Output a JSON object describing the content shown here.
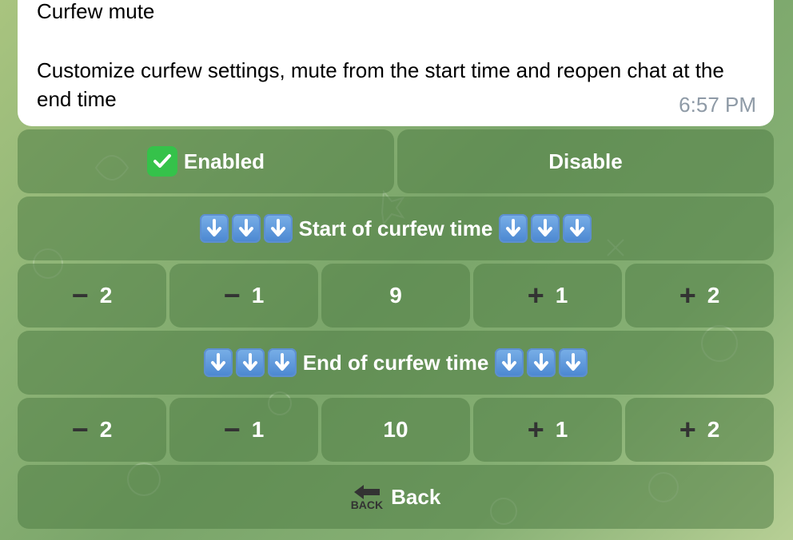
{
  "message": {
    "title": "Curfew mute",
    "body": "Customize curfew settings, mute from the start time and reopen chat at the end time",
    "time": "6:57 PM"
  },
  "keyboard": {
    "enabled_label": "Enabled",
    "disable_label": "Disable",
    "start_header": "Start of curfew time",
    "end_header": "End of curfew time",
    "start_row": {
      "minus2": "2",
      "minus1": "1",
      "value": "9",
      "plus1": "1",
      "plus2": "2"
    },
    "end_row": {
      "minus2": "2",
      "minus1": "1",
      "value": "10",
      "plus1": "1",
      "plus2": "2"
    },
    "back_label": "Back",
    "back_icon_text": "BACK"
  },
  "icons": {
    "enabled": "check-mark-icon",
    "arrows": "down-arrow-icon",
    "minus": "minus-icon",
    "plus": "plus-icon",
    "back": "back-arrow-icon"
  },
  "colors": {
    "button_fill": "#507d46",
    "check_green": "#35c24a",
    "arrow_blue": "#4a86d0",
    "time_gray": "#8e9aa6"
  }
}
